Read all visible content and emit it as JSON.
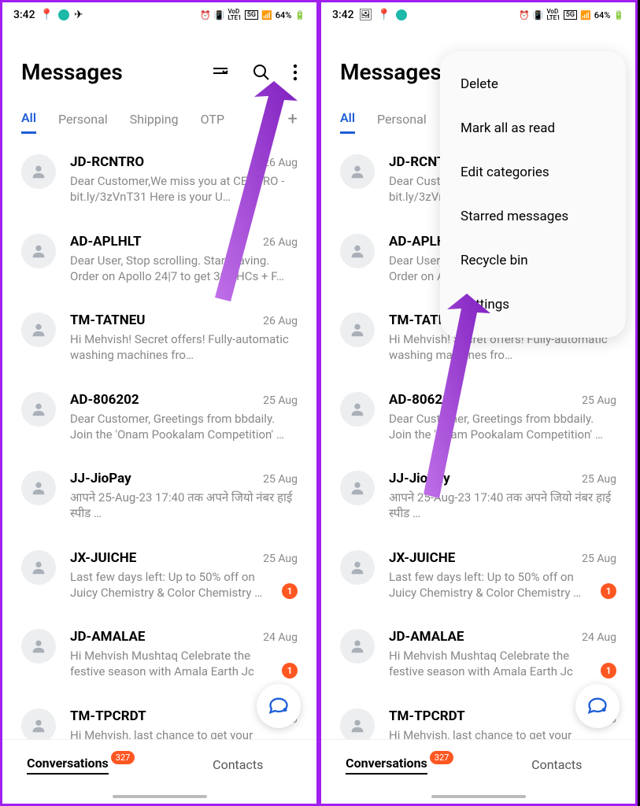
{
  "status": {
    "time": "3:42",
    "battery": "64%",
    "net_lte": "LTE1",
    "net_vod": "VoLTE",
    "net_5g": "5G"
  },
  "header": {
    "title": "Messages"
  },
  "tabs": [
    {
      "label": "All",
      "active": true
    },
    {
      "label": "Personal",
      "active": false
    },
    {
      "label": "Shipping",
      "active": false
    },
    {
      "label": "OTP",
      "active": false
    }
  ],
  "messages": [
    {
      "sender": "JD-RCNTRO",
      "date": "26 Aug",
      "preview": "Dear Customer,We miss you at CENTRO - bit.ly/3zVnT31 Here is your U…",
      "unread": 0
    },
    {
      "sender": "AD-APLHLT",
      "date": "26 Aug",
      "preview": "Dear User,  Stop scrolling. Start saving. Order on Apollo 24|7 to get 300 HCs + F…",
      "unread": 0
    },
    {
      "sender": "TM-TATNEU",
      "date": "26 Aug",
      "preview": "Hi Mehvish! Secret offers! Fully-automatic washing machines fro…",
      "unread": 0
    },
    {
      "sender": "AD-806202",
      "date": "25 Aug",
      "preview": "Dear Customer, Greetings from bbdaily. Join the 'Onam Pookalam Competition' …",
      "unread": 0
    },
    {
      "sender": "JJ-JioPay",
      "date": "25 Aug",
      "preview": "आपने 25-Aug-23 17:40 तक अपने जियो नंबर                                           हाई स्पीड …",
      "unread": 0
    },
    {
      "sender": "JX-JUICHE",
      "date": "25 Aug",
      "preview": "Last few days left: Up to 50% off on Juicy Chemistry & Color Chemistry …",
      "unread": 1
    },
    {
      "sender": "JD-AMALAE",
      "date": "24 Aug",
      "preview": "Hi Mehvish Mushtaq Celebrate the festive season with Amala Earth Jc",
      "unread": 1
    },
    {
      "sender": "TM-TPCRDT",
      "date": "24 Aug",
      "preview": "Hi Mehvish, last chance to get your",
      "unread": 0
    }
  ],
  "bottom": {
    "conversations": "Conversations",
    "conv_badge": "327",
    "contacts": "Contacts"
  },
  "menu": [
    "Delete",
    "Mark all as read",
    "Edit categories",
    "Starred messages",
    "Recycle bin",
    "Settings"
  ]
}
